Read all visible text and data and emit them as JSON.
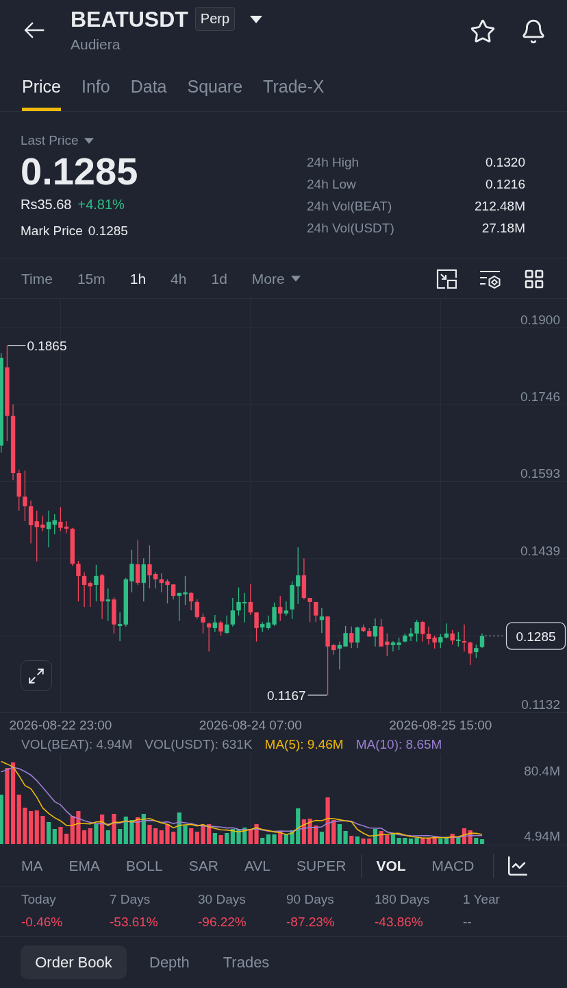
{
  "header": {
    "title": "BEATUSDT",
    "badge": "Perp",
    "subtitle": "Audiera"
  },
  "tabs": [
    {
      "label": "Price",
      "selected": true
    },
    {
      "label": "Info",
      "selected": false
    },
    {
      "label": "Data",
      "selected": false
    },
    {
      "label": "Square",
      "selected": false
    },
    {
      "label": "Trade-X",
      "selected": false
    }
  ],
  "ticker": {
    "label": "Last Price",
    "price": "0.1285",
    "fiat_price": "Rs35.68",
    "change": "+4.81%",
    "positive": true,
    "mark_label": "Mark Price",
    "mark_price": "0.1285"
  },
  "stats": [
    {
      "label": "24h High",
      "value": "0.1320"
    },
    {
      "label": "24h Low",
      "value": "0.1216"
    },
    {
      "label": "24h Vol(BEAT)",
      "value": "212.48M"
    },
    {
      "label": "24h Vol(USDT)",
      "value": "27.18M"
    }
  ],
  "intervals": [
    {
      "label": "Time",
      "selected": false
    },
    {
      "label": "15m",
      "selected": false
    },
    {
      "label": "1h",
      "selected": true
    },
    {
      "label": "4h",
      "selected": false
    },
    {
      "label": "1d",
      "selected": false
    }
  ],
  "more_menu": {
    "label": "More"
  },
  "chart": {
    "chart_data": {
      "type": "candlestick",
      "grid": true,
      "categories": [
        null,
        null,
        null,
        null,
        null,
        null,
        null,
        null,
        null,
        null,
        "2026-08-22 23:00",
        null,
        null,
        null,
        null,
        null,
        null,
        null,
        null,
        null,
        null,
        null,
        null,
        null,
        null,
        null,
        null,
        null,
        null,
        null,
        null,
        null,
        null,
        null,
        null,
        null,
        null,
        null,
        null,
        null,
        null,
        null,
        "2026-08-24 07:00",
        null,
        null,
        null,
        null,
        null,
        null,
        null,
        null,
        null,
        null,
        null,
        null,
        null,
        null,
        null,
        null,
        null,
        null,
        null,
        null,
        null,
        null,
        null,
        null,
        null,
        null,
        null,
        null,
        null,
        null,
        null,
        "2026-08-25 15:00",
        null,
        null,
        null,
        null,
        null,
        null,
        null
      ],
      "ohlc": [
        [
          0.1665,
          0.1849,
          0.1651,
          0.184
        ],
        [
          0.1821,
          0.1865,
          0.1674,
          0.1724
        ],
        [
          0.1724,
          0.1747,
          0.1596,
          0.161
        ],
        [
          0.161,
          0.1617,
          0.1535,
          0.1563
        ],
        [
          0.1563,
          0.1615,
          0.1514,
          0.1544
        ],
        [
          0.1544,
          0.1555,
          0.147,
          0.1506
        ],
        [
          0.1514,
          0.1535,
          0.1434,
          0.1502
        ],
        [
          0.1507,
          0.1525,
          0.1494,
          0.1501
        ],
        [
          0.1498,
          0.1535,
          0.1462,
          0.1513
        ],
        [
          0.1507,
          0.1528,
          0.1488,
          0.1516
        ],
        [
          0.1513,
          0.1542,
          0.1494,
          0.1501
        ],
        [
          0.1503,
          0.1514,
          0.149,
          0.1499
        ],
        [
          0.1499,
          0.1501,
          0.1425,
          0.1429
        ],
        [
          0.1429,
          0.1435,
          0.1354,
          0.1405
        ],
        [
          0.1405,
          0.1412,
          0.1343,
          0.1387
        ],
        [
          0.1391,
          0.1394,
          0.1343,
          0.1384
        ],
        [
          0.1387,
          0.1427,
          0.1354,
          0.1405
        ],
        [
          0.1406,
          0.1409,
          0.1319,
          0.1354
        ],
        [
          0.1354,
          0.138,
          0.1315,
          0.1358
        ],
        [
          0.1358,
          0.1362,
          0.129,
          0.1308
        ],
        [
          0.1305,
          0.1332,
          0.1275,
          0.1309
        ],
        [
          0.1308,
          0.1401,
          0.1304,
          0.1398
        ],
        [
          0.1394,
          0.1457,
          0.1372,
          0.1429
        ],
        [
          0.1428,
          0.1477,
          0.1387,
          0.1391
        ],
        [
          0.1391,
          0.144,
          0.1354,
          0.1428
        ],
        [
          0.1428,
          0.1466,
          0.138,
          0.1406
        ],
        [
          0.1409,
          0.1412,
          0.138,
          0.1398
        ],
        [
          0.1398,
          0.141,
          0.1372,
          0.1391
        ],
        [
          0.1394,
          0.1398,
          0.135,
          0.1387
        ],
        [
          0.1388,
          0.1388,
          0.1358,
          0.1365
        ],
        [
          0.1365,
          0.1371,
          0.1315,
          0.1371
        ],
        [
          0.1368,
          0.1405,
          0.1347,
          0.1372
        ],
        [
          0.1371,
          0.1372,
          0.1336,
          0.1354
        ],
        [
          0.1353,
          0.1358,
          0.1319,
          0.1323
        ],
        [
          0.1323,
          0.133,
          0.129,
          0.1312
        ],
        [
          0.131,
          0.1312,
          0.1254,
          0.1302
        ],
        [
          0.1301,
          0.1327,
          0.1293,
          0.1312
        ],
        [
          0.1312,
          0.1315,
          0.1286,
          0.1294
        ],
        [
          0.1291,
          0.1326,
          0.129,
          0.1308
        ],
        [
          0.1308,
          0.1361,
          0.1304,
          0.1336
        ],
        [
          0.1336,
          0.1382,
          0.1326,
          0.1353
        ],
        [
          0.135,
          0.1371,
          0.1312,
          0.1353
        ],
        [
          0.1353,
          0.1388,
          0.1327,
          0.1332
        ],
        [
          0.1332,
          0.1332,
          0.1274,
          0.1301
        ],
        [
          0.1302,
          0.1313,
          0.1293,
          0.1309
        ],
        [
          0.1301,
          0.1326,
          0.1297,
          0.1312
        ],
        [
          0.1308,
          0.1352,
          0.1305,
          0.1343
        ],
        [
          0.1343,
          0.1365,
          0.1315,
          0.133
        ],
        [
          0.133,
          0.1354,
          0.1326,
          0.1336
        ],
        [
          0.1338,
          0.1394,
          0.1319,
          0.1387
        ],
        [
          0.1384,
          0.1462,
          0.1349,
          0.1406
        ],
        [
          0.1406,
          0.144,
          0.1358,
          0.1361
        ],
        [
          0.1361,
          0.1361,
          0.1313,
          0.1353
        ],
        [
          0.1353,
          0.1353,
          0.1313,
          0.1326
        ],
        [
          0.1317,
          0.1341,
          0.1291,
          0.1324
        ],
        [
          0.1324,
          0.1324,
          0.1167,
          0.1264
        ],
        [
          0.1267,
          0.1269,
          0.1248,
          0.1257
        ],
        [
          0.126,
          0.1274,
          0.1218,
          0.1267
        ],
        [
          0.1264,
          0.1305,
          0.1264,
          0.1291
        ],
        [
          0.1291,
          0.1304,
          0.1261,
          0.1272
        ],
        [
          0.1272,
          0.1304,
          0.1261,
          0.1302
        ],
        [
          0.1302,
          0.1308,
          0.1293,
          0.1295
        ],
        [
          0.1295,
          0.1301,
          0.1283,
          0.1284
        ],
        [
          0.1284,
          0.132,
          0.1264,
          0.1305
        ],
        [
          0.1304,
          0.1319,
          0.1264,
          0.1264
        ],
        [
          0.1274,
          0.129,
          0.1245,
          0.1267
        ],
        [
          0.1267,
          0.1275,
          0.1254,
          0.1272
        ],
        [
          0.1267,
          0.1282,
          0.1257,
          0.1272
        ],
        [
          0.1274,
          0.129,
          0.1272,
          0.1286
        ],
        [
          0.1284,
          0.1301,
          0.1275,
          0.129
        ],
        [
          0.129,
          0.1317,
          0.1274,
          0.1313
        ],
        [
          0.1313,
          0.1315,
          0.1274,
          0.1289
        ],
        [
          0.1289,
          0.1304,
          0.1268,
          0.1279
        ],
        [
          0.1282,
          0.1286,
          0.126,
          0.1272
        ],
        [
          0.1272,
          0.1289,
          0.1261,
          0.1283
        ],
        [
          0.1282,
          0.131,
          0.128,
          0.129
        ],
        [
          0.129,
          0.1297,
          0.1268,
          0.1276
        ],
        [
          0.1275,
          0.1293,
          0.1264,
          0.1278
        ],
        [
          0.1275,
          0.1308,
          0.1254,
          0.1272
        ],
        [
          0.1272,
          0.1274,
          0.1227,
          0.125
        ],
        [
          0.1253,
          0.1268,
          0.1241,
          0.1261
        ],
        [
          0.1263,
          0.129,
          0.1261,
          0.1285
        ]
      ],
      "ylim": [
        0.1132,
        0.19
      ],
      "yticks": [
        {
          "value": 0.19,
          "label": "0.1900"
        },
        {
          "value": 0.1746,
          "label": "0.1746"
        },
        {
          "value": 0.1593,
          "label": "0.1593"
        },
        {
          "value": 0.1439,
          "label": "0.1439"
        },
        {
          "value": 0.1132,
          "label": "0.1132"
        }
      ]
    },
    "high_marker": "0.1865",
    "low_marker": "0.1167",
    "last_price_tag": "0.1285"
  },
  "volume": {
    "legend": [
      {
        "text": "VOL(BEAT): 4.94M",
        "color": "#848e9c"
      },
      {
        "text": "VOL(USDT): 631K",
        "color": "#848e9c"
      },
      {
        "text": "MA(5): 9.46M",
        "color": "#f0b90b"
      },
      {
        "text": "MA(10): 8.65M",
        "color": "#9b7fd4"
      }
    ],
    "axis_labels": [
      "80.4M",
      "4.94M"
    ]
  },
  "indicators": {
    "main": [
      {
        "label": "MA",
        "selected": false
      },
      {
        "label": "EMA",
        "selected": false
      },
      {
        "label": "BOLL",
        "selected": false
      },
      {
        "label": "SAR",
        "selected": false
      },
      {
        "label": "AVL",
        "selected": false
      },
      {
        "label": "SUPER",
        "selected": false
      }
    ],
    "sub": [
      {
        "label": "VOL",
        "selected": true
      },
      {
        "label": "MACD",
        "selected": false
      }
    ]
  },
  "performance": [
    {
      "label": "Today",
      "value": "-0.46%",
      "negative": true
    },
    {
      "label": "7 Days",
      "value": "-53.61%",
      "negative": true
    },
    {
      "label": "30 Days",
      "value": "-96.22%",
      "negative": true
    },
    {
      "label": "90 Days",
      "value": "-87.23%",
      "negative": true
    },
    {
      "label": "180 Days",
      "value": "-43.86%",
      "negative": true
    },
    {
      "label": "1 Year",
      "value": "--",
      "negative": false
    }
  ],
  "bottom_tabs": [
    {
      "label": "Order Book",
      "selected": true
    },
    {
      "label": "Depth",
      "selected": false
    },
    {
      "label": "Trades",
      "selected": false
    }
  ]
}
